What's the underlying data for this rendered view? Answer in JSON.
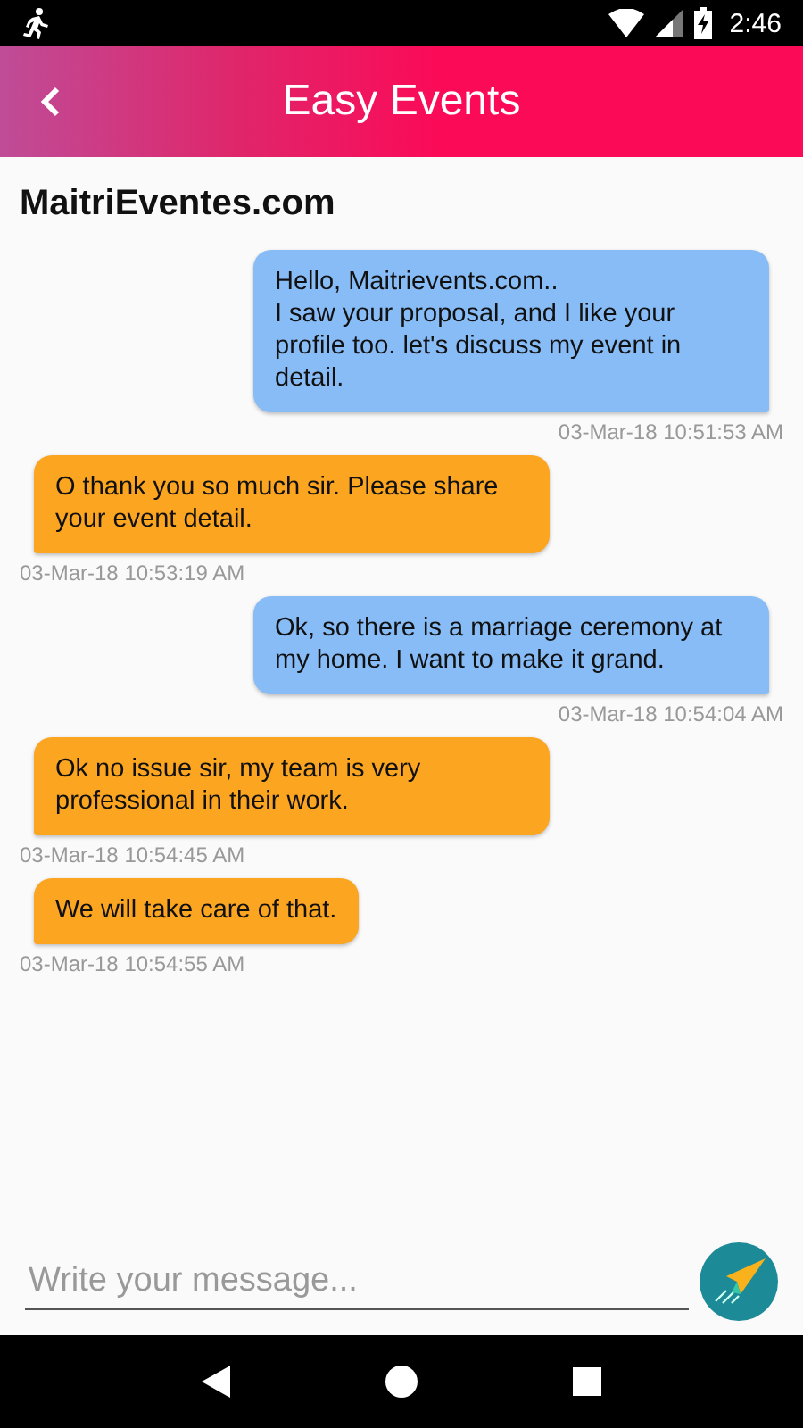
{
  "status_bar": {
    "time": "2:46"
  },
  "app_bar": {
    "title": "Easy Events"
  },
  "chat": {
    "contact": "MaitriEventes.com",
    "messages": [
      {
        "kind": "sent",
        "text": "Hello, Maitrievents.com..\nI saw your proposal, and I like your profile too. let's discuss my event in detail.",
        "time": "03-Mar-18 10:51:53 AM"
      },
      {
        "kind": "received",
        "text": "O thank you so much sir. Please share your event detail.",
        "time": "03-Mar-18 10:53:19 AM"
      },
      {
        "kind": "sent",
        "text": "Ok, so there is a marriage ceremony at my home. I want to make it grand.",
        "time": "03-Mar-18 10:54:04 AM"
      },
      {
        "kind": "received",
        "text": "Ok no issue sir, my team is very professional in their work.",
        "time": "03-Mar-18 10:54:45 AM"
      },
      {
        "kind": "received",
        "text": "We will take care of that.",
        "time": "03-Mar-18 10:54:55 AM"
      }
    ]
  },
  "composer": {
    "placeholder": "Write your message..."
  }
}
